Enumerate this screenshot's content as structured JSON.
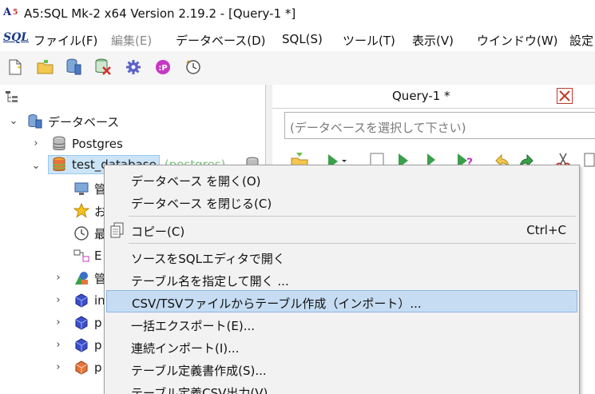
{
  "window": {
    "title": "A5:SQL Mk-2 x64 Version 2.19.2 - [Query-1 *]"
  },
  "menubar": {
    "logo": "SQL",
    "items": [
      {
        "label": "ファイル(F)",
        "disabled": false
      },
      {
        "label": "編集(E)",
        "disabled": true
      },
      {
        "label": "データベース(D)",
        "disabled": false
      },
      {
        "label": "SQL(S)",
        "disabled": false
      },
      {
        "label": "ツール(T)",
        "disabled": false
      },
      {
        "label": "表示(V)",
        "disabled": false
      },
      {
        "label": "ウインドウ(W)",
        "disabled": false
      },
      {
        "label": "設定",
        "disabled": false
      }
    ]
  },
  "toolbar": {
    "icons": [
      "new-file-icon",
      "open-folder-icon",
      "database-icon",
      "database-error-icon",
      "gear-icon",
      "plugin-icon",
      "clock-icon"
    ]
  },
  "tree": {
    "root_label": "データベース",
    "postgres_label": "Postgres",
    "selected_label": "test_database",
    "selected_suffix": "(postgres)",
    "child_partial": [
      "管",
      "お",
      "最",
      "E",
      "管",
      "in",
      "p",
      "p",
      "p"
    ]
  },
  "editor": {
    "tab_label": "Query-1 *",
    "db_select_placeholder": "(データベースを選択して下さい)"
  },
  "context_menu": {
    "items": [
      {
        "label": "データベース を開く(O)",
        "shortcut": "",
        "icon": ""
      },
      {
        "label": "データベース を閉じる(C)",
        "shortcut": "",
        "icon": ""
      },
      {
        "label": "コピー(C)",
        "shortcut": "Ctrl+C",
        "icon": "copy-icon"
      },
      {
        "label": "ソースをSQLエディタで開く",
        "shortcut": "",
        "icon": ""
      },
      {
        "label": "テーブル名を指定して開く ...",
        "shortcut": "",
        "icon": ""
      },
      {
        "label": "CSV/TSVファイルからテーブル作成（インポート）...",
        "shortcut": "",
        "icon": ""
      },
      {
        "label": "一括エクスポート(E)...",
        "shortcut": "",
        "icon": ""
      },
      {
        "label": "連続インポート(I)...",
        "shortcut": "",
        "icon": ""
      },
      {
        "label": "テーブル定義書作成(S)...",
        "shortcut": "",
        "icon": ""
      },
      {
        "label": "テーブル定義CSV出力(V)",
        "shortcut": "",
        "icon": ""
      }
    ],
    "highlighted_index": 5
  },
  "colors": {
    "highlight": "#c5dcf2",
    "selection": "#cce4f7",
    "close_red": "#c0392b"
  }
}
